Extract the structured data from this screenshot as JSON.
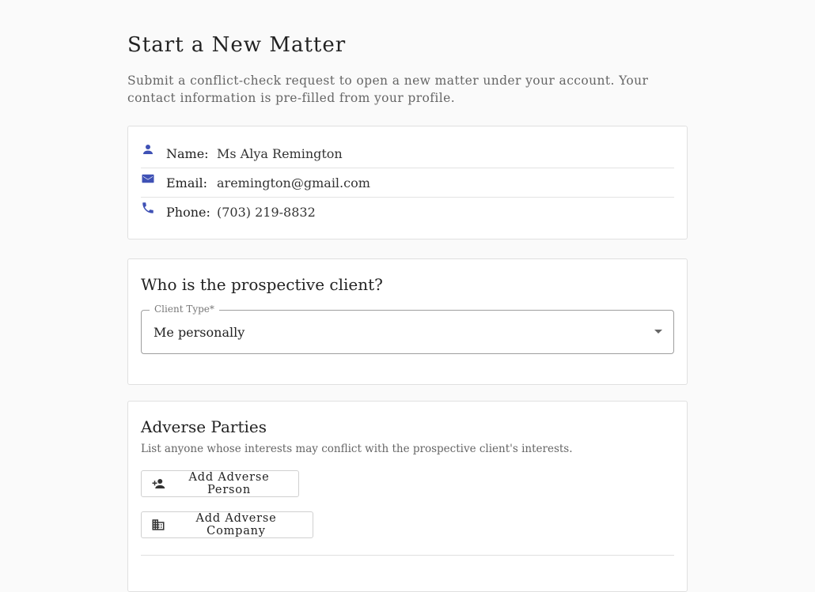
{
  "page": {
    "title": "Start a New Matter",
    "intro": "Submit a conflict-check request to open a new matter under your account. Your contact information is pre-filled from your profile."
  },
  "contact": {
    "name_label": "Name:",
    "name_value": "Ms Alya Remington",
    "email_label": "Email:",
    "email_value": "aremington@gmail.com",
    "phone_label": "Phone:",
    "phone_value": "(703) 219-8832",
    "icons": [
      "person-icon",
      "mail-icon",
      "phone-icon"
    ]
  },
  "client": {
    "heading": "Who is the prospective client?",
    "select_label": "Client Type*",
    "select_value": "Me personally"
  },
  "adverse": {
    "heading": "Adverse Parties",
    "description": "List anyone whose interests may conflict with the prospective client's interests.",
    "add_person_label": "Add Adverse Person",
    "add_company_label": "Add Adverse Company"
  },
  "colors": {
    "accent": "#3f51b5",
    "border": "#e0e0e0",
    "muted_text": "#666666"
  }
}
